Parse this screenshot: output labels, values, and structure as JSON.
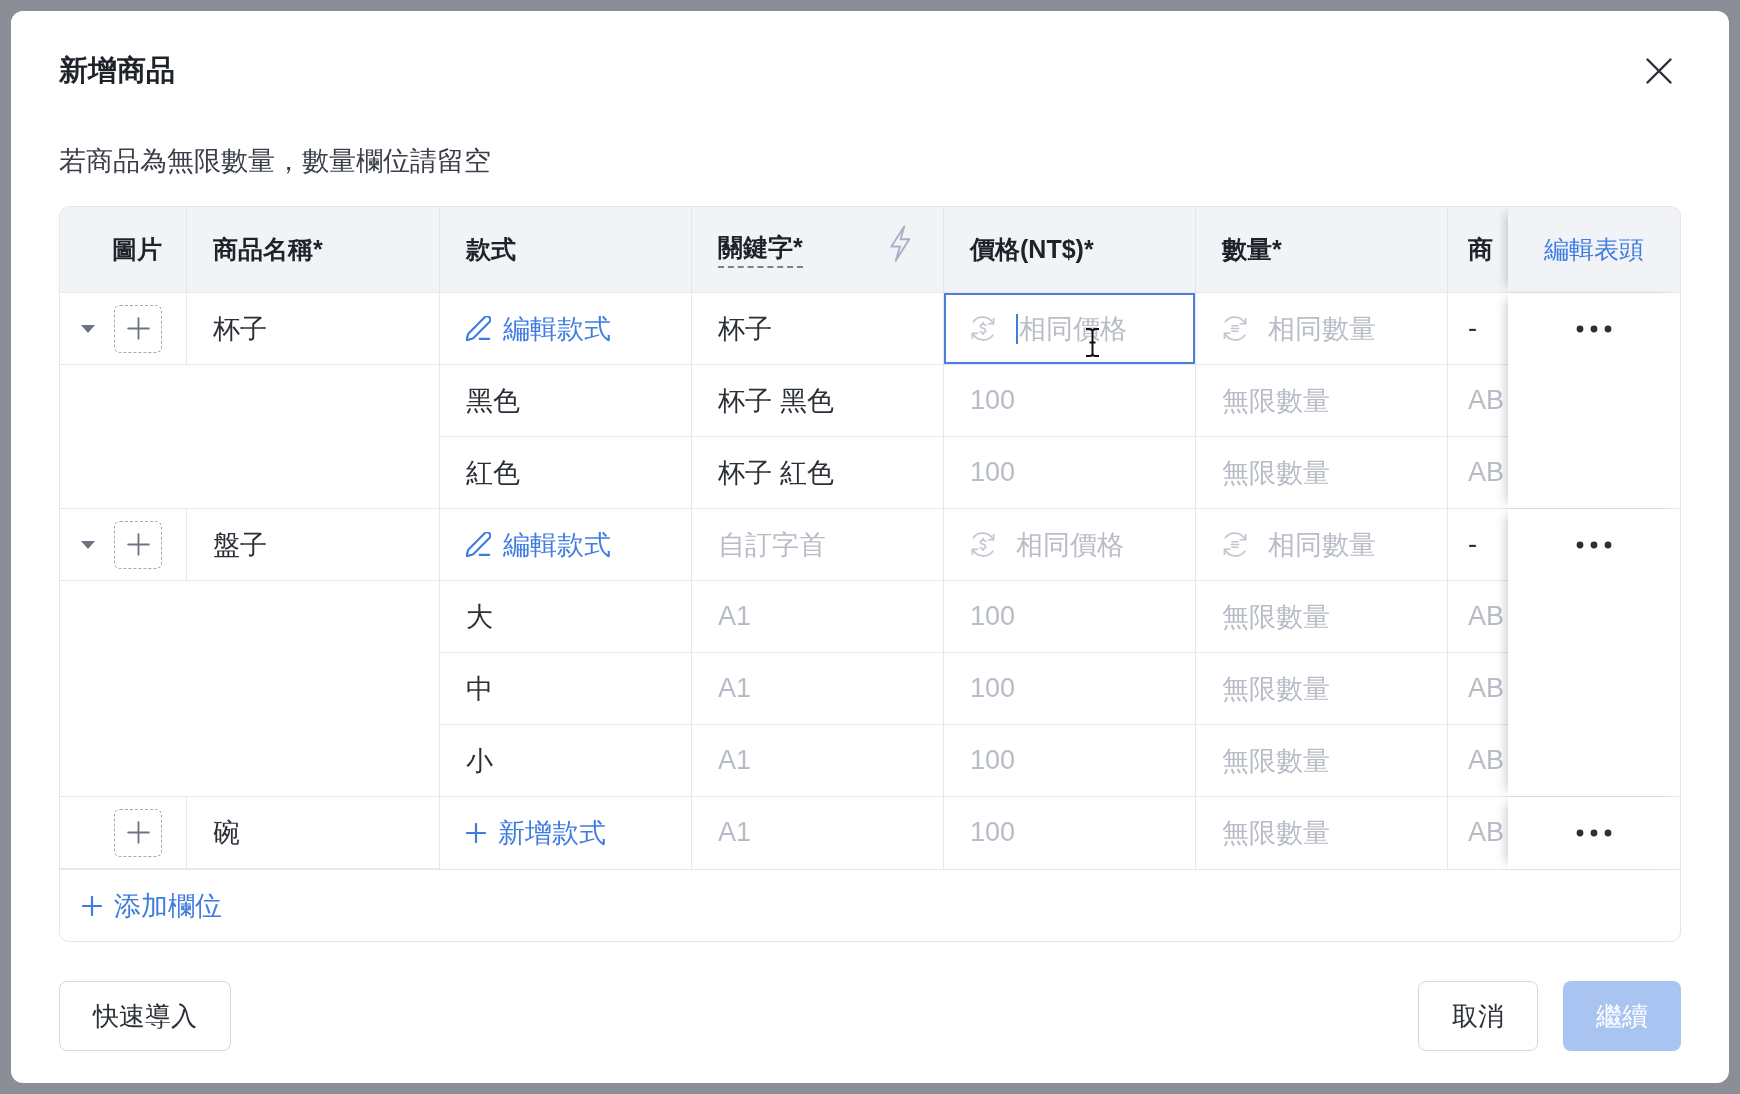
{
  "dialog": {
    "title": "新增商品",
    "hint": "若商品為無限數量，數量欄位請留空"
  },
  "table": {
    "columns": [
      {
        "kind": "image",
        "label": "圖片"
      },
      {
        "kind": "plain",
        "label": "商品名稱*"
      },
      {
        "kind": "plain",
        "label": "款式"
      },
      {
        "kind": "keyword",
        "label": "關鍵字*"
      },
      {
        "kind": "plain",
        "label": "價格(NT$)*"
      },
      {
        "kind": "plain",
        "label": "數量*"
      },
      {
        "kind": "plain",
        "label": "商"
      }
    ],
    "edit_header_link": "編輯表頭",
    "products": [
      {
        "expanded": true,
        "name": {
          "value": "杯子"
        },
        "style": {
          "kind": "edit",
          "label": "編輯款式"
        },
        "keyword": {
          "value": "杯子"
        },
        "price": {
          "kind": "linked",
          "placeholder": "相同價格",
          "focused": true
        },
        "quantity": {
          "kind": "linked",
          "placeholder": "相同數量"
        },
        "column_7": {
          "value": "-"
        },
        "variants": [
          {
            "style": "黑色",
            "keyword": {
              "value": "杯子 黑色"
            },
            "price": {
              "placeholder": "100"
            },
            "quantity": {
              "placeholder": "無限數量"
            },
            "column_7": {
              "placeholder": "AB"
            }
          },
          {
            "style": "紅色",
            "keyword": {
              "value": "杯子 紅色"
            },
            "price": {
              "placeholder": "100"
            },
            "quantity": {
              "placeholder": "無限數量"
            },
            "column_7": {
              "placeholder": "AB"
            }
          }
        ]
      },
      {
        "expanded": true,
        "name": {
          "value": "盤子"
        },
        "style": {
          "kind": "edit",
          "label": "編輯款式"
        },
        "keyword": {
          "placeholder": "自訂字首"
        },
        "price": {
          "kind": "linked",
          "placeholder": "相同價格",
          "focused": false
        },
        "quantity": {
          "kind": "linked",
          "placeholder": "相同數量"
        },
        "column_7": {
          "value": "-"
        },
        "variants": [
          {
            "style": "大",
            "keyword": {
              "placeholder": "A1"
            },
            "price": {
              "placeholder": "100"
            },
            "quantity": {
              "placeholder": "無限數量"
            },
            "column_7": {
              "placeholder": "AB"
            }
          },
          {
            "style": "中",
            "keyword": {
              "placeholder": "A1"
            },
            "price": {
              "placeholder": "100"
            },
            "quantity": {
              "placeholder": "無限數量"
            },
            "column_7": {
              "placeholder": "AB"
            }
          },
          {
            "style": "小",
            "keyword": {
              "placeholder": "A1"
            },
            "price": {
              "placeholder": "100"
            },
            "quantity": {
              "placeholder": "無限數量"
            },
            "column_7": {
              "placeholder": "AB"
            }
          }
        ]
      },
      {
        "name": {
          "value": "碗"
        },
        "style": {
          "kind": "add",
          "label": "新增款式"
        },
        "keyword": {
          "placeholder": "A1"
        },
        "price": {
          "kind": "plain",
          "placeholder": "100",
          "focused": false
        },
        "quantity": {
          "kind": "plain",
          "placeholder": "無限數量"
        },
        "column_7": {
          "placeholder": "AB"
        }
      }
    ],
    "add_field_link": "添加欄位"
  },
  "footer": {
    "left_buttons": [
      {
        "label": "快速導入",
        "kind": "secondary",
        "disabled": false
      }
    ],
    "right_buttons": [
      {
        "label": "取消",
        "kind": "secondary",
        "disabled": false
      },
      {
        "label": "繼續",
        "kind": "primary",
        "disabled": true
      }
    ]
  }
}
